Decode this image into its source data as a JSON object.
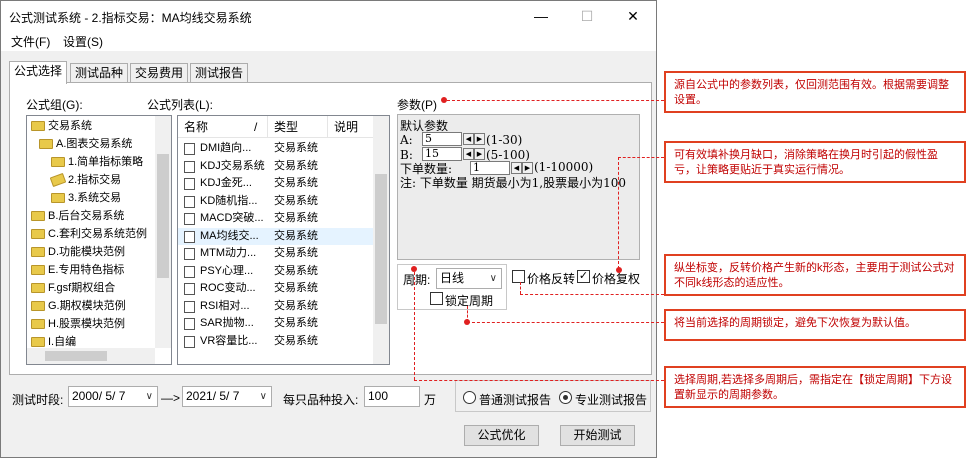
{
  "window": {
    "title": "公式测试系统 - 2.指标交易：MA均线交易系统",
    "minimize": "—",
    "maximize": "☐",
    "close": "✕"
  },
  "menu": {
    "file": "文件(F)",
    "settings": "设置(S)"
  },
  "tabs": [
    "公式选择",
    "测试品种",
    "交易费用",
    "测试报告"
  ],
  "formula_group": {
    "label": "公式组(G):",
    "items": [
      "交易系统",
      "A.图表交易系统",
      "1.简单指标策略",
      "2.指标交易",
      "3.系统交易",
      "B.后台交易系统",
      "C.套利交易系统范例",
      "D.功能模块范例",
      "E.专用特色指标",
      "F.gsf期权组合",
      "G.期权模块范例",
      "H.股票模块范例",
      "I.自编"
    ]
  },
  "formula_list": {
    "label": "公式列表(L):",
    "columns": [
      "名称",
      "/",
      "类型",
      "说明"
    ],
    "rows": [
      {
        "name": "DMI趋向...",
        "type": "交易系统"
      },
      {
        "name": "KDJ交易系统",
        "type": "交易系统"
      },
      {
        "name": "KDJ金死...",
        "type": "交易系统"
      },
      {
        "name": "KD随机指...",
        "type": "交易系统"
      },
      {
        "name": "MACD突破...",
        "type": "交易系统"
      },
      {
        "name": "MA均线交...",
        "type": "交易系统"
      },
      {
        "name": "MTM动力...",
        "type": "交易系统"
      },
      {
        "name": "PSY心理...",
        "type": "交易系统"
      },
      {
        "name": "ROC变动...",
        "type": "交易系统"
      },
      {
        "name": "RSI相对...",
        "type": "交易系统"
      },
      {
        "name": "SAR抛物...",
        "type": "交易系统"
      },
      {
        "name": "VR容量比...",
        "type": "交易系统"
      }
    ]
  },
  "params": {
    "label": "参数(P)",
    "heading": "默认参数",
    "a_label": "A:",
    "a_value": "5",
    "a_range": "(1-30)",
    "b_label": "B:",
    "b_value": "15",
    "b_range": "(5-100)",
    "qty_label": "下单数量:",
    "qty_value": "1",
    "qty_range": "(1-10000)",
    "note": "注: 下单数量 期货最小为1,股票最小为100"
  },
  "period": {
    "label": "周期:",
    "value": "日线",
    "reverse_label": "价格反转",
    "reverse_checked": false,
    "restore_label": "价格复权",
    "restore_checked": true,
    "lock_label": "锁定周期",
    "lock_checked": false
  },
  "bottom": {
    "test_period_label": "测试时段:",
    "start_date": "2000/ 5/ 7",
    "arrow": "—>",
    "end_date": "2021/ 5/ 7",
    "invest_label": "每只品种投入:",
    "invest_value": "100",
    "invest_unit": "万",
    "normal_report": "普通测试报告",
    "pro_report": "专业测试报告",
    "selected_report": "pro",
    "optimize_button": "公式优化",
    "start_button": "开始测试"
  },
  "callouts": [
    "源自公式中的参数列表，仅回测范围有效。根据需要调整设置。",
    "可有效填补换月缺口，消除策略在换月时引起的假性盈亏，让策略更贴近于真实运行情况。",
    "纵坐标变，反转价格产生新的k形态，主要用于测试公式对不同k线形态的适应性。",
    "将当前选择的周期锁定，避免下次恢复为默认值。",
    "选择周期,若选择多周期后，需指定在【锁定周期】下方设置新显示的周期参数。"
  ],
  "colors": {
    "callout_border": "#e04020",
    "callout_text": "#c00000",
    "annotation_line": "#e02020",
    "selected_row": "#e5f3ff"
  }
}
